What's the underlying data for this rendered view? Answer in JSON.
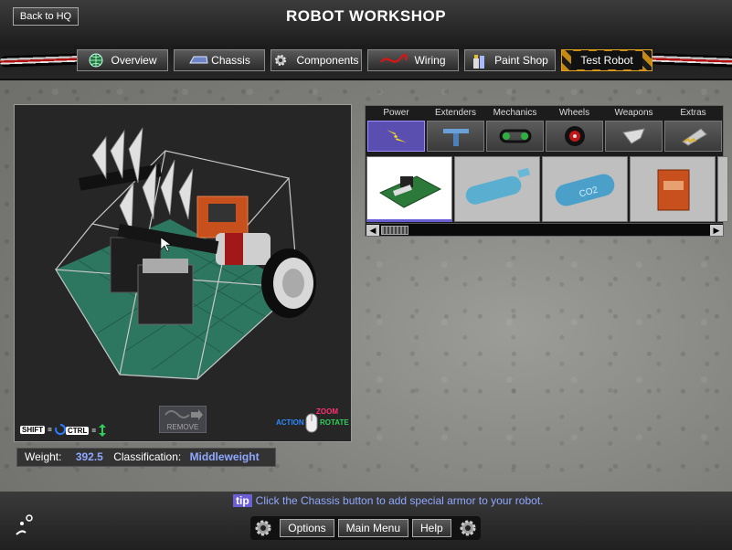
{
  "header": {
    "title": "ROBOT WORKSHOP",
    "back_label": "Back to HQ"
  },
  "tabs": [
    {
      "label": "Overview",
      "icon": "globe-icon"
    },
    {
      "label": "Chassis",
      "icon": "chassis-icon"
    },
    {
      "label": "Components",
      "icon": "gear-icon"
    },
    {
      "label": "Wiring",
      "icon": "wire-icon"
    },
    {
      "label": "Paint Shop",
      "icon": "paint-icon"
    },
    {
      "label": "Test Robot",
      "icon": "hazard-stripes"
    }
  ],
  "viewport": {
    "shift_key": "SHIFT",
    "ctrl_key": "CTRL",
    "remove_label": "REMOVE",
    "mouse_action": "ACTION",
    "mouse_zoom": "ZOOM",
    "mouse_rotate": "ROTATE"
  },
  "stats": {
    "weight_label": "Weight:",
    "weight_value": "392.5",
    "class_label": "Classification:",
    "class_value": "Middleweight"
  },
  "parts": {
    "categories": [
      {
        "label": "Power",
        "icon": "lightning-icon",
        "active": true
      },
      {
        "label": "Extenders",
        "icon": "extender-icon",
        "active": false
      },
      {
        "label": "Mechanics",
        "icon": "chain-icon",
        "active": false
      },
      {
        "label": "Wheels",
        "icon": "wheel-icon",
        "active": false
      },
      {
        "label": "Weapons",
        "icon": "blade-icon",
        "active": false
      },
      {
        "label": "Extras",
        "icon": "plow-icon",
        "active": false
      }
    ],
    "items": [
      {
        "name": "circuit-board",
        "active": true
      },
      {
        "name": "gas-cylinder",
        "active": false
      },
      {
        "name": "co2-tank",
        "active": false
      },
      {
        "name": "battery-pack",
        "active": false
      }
    ]
  },
  "footer": {
    "tip_badge": "tip",
    "tip_text": "Click the Chassis button to add special armor to your robot.",
    "options_label": "Options",
    "main_menu_label": "Main Menu",
    "help_label": "Help"
  },
  "colors": {
    "accent": "#6b5fd6",
    "value_blue": "#8fa8ff",
    "grid_green": "#2d7a62",
    "hazard_orange": "#c48a14"
  }
}
